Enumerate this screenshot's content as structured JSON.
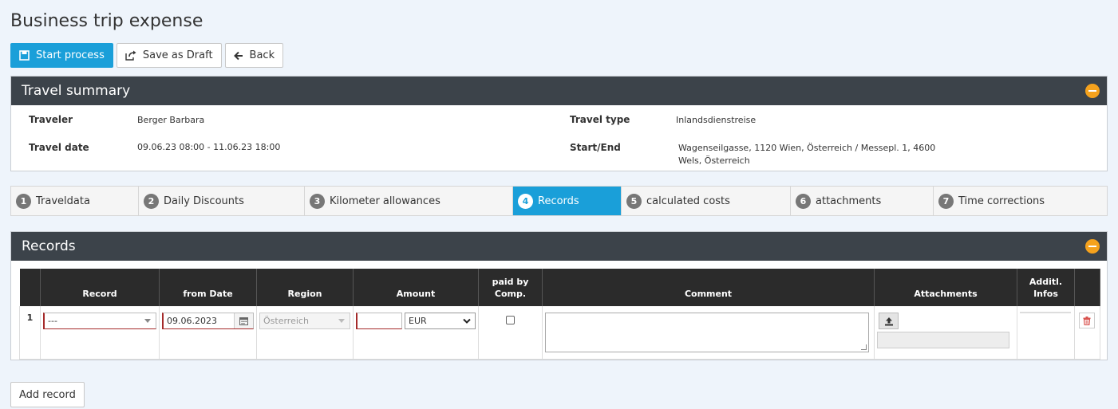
{
  "page": {
    "title": "Business trip expense"
  },
  "toolbar": {
    "start_process": "Start process",
    "save_draft": "Save as Draft",
    "back": "Back"
  },
  "summary": {
    "title": "Travel summary",
    "traveler_label": "Traveler",
    "traveler": "Berger Barbara",
    "travel_type_label": "Travel type",
    "travel_type": "Inlandsdienstreise",
    "travel_date_label": "Travel date",
    "travel_date": "09.06.23 08:00 - 11.06.23 18:00",
    "start_end_label": "Start/End",
    "start_end_line1": "Wagenseilgasse, 1120 Wien, Österreich / Messepl. 1, 4600",
    "start_end_line2": "Wels, Österreich"
  },
  "tabs": [
    {
      "num": "1",
      "label": "Traveldata"
    },
    {
      "num": "2",
      "label": "Daily Discounts"
    },
    {
      "num": "3",
      "label": "Kilometer allowances"
    },
    {
      "num": "4",
      "label": "Records",
      "active": true
    },
    {
      "num": "5",
      "label": "calculated costs"
    },
    {
      "num": "6",
      "label": "attachments"
    },
    {
      "num": "7",
      "label": "Time corrections"
    }
  ],
  "records": {
    "title": "Records",
    "columns": {
      "record": "Record",
      "from_date": "from Date",
      "region": "Region",
      "amount": "Amount",
      "paid_by_comp": "paid by Comp.",
      "comment": "Comment",
      "attachments": "Attachments",
      "additl_infos": "Additl. Infos"
    },
    "rows": [
      {
        "num": "1",
        "record": "---",
        "from_date": "09.06.2023",
        "region": "Österreich",
        "amount": "",
        "currency": "EUR",
        "paid_by_comp": false,
        "comment": ""
      }
    ],
    "add_record": "Add record"
  },
  "colors": {
    "primary": "#1a9fd9",
    "header_dark": "#3c434a",
    "collapse": "#f5a21d",
    "delete": "#d9534f"
  }
}
